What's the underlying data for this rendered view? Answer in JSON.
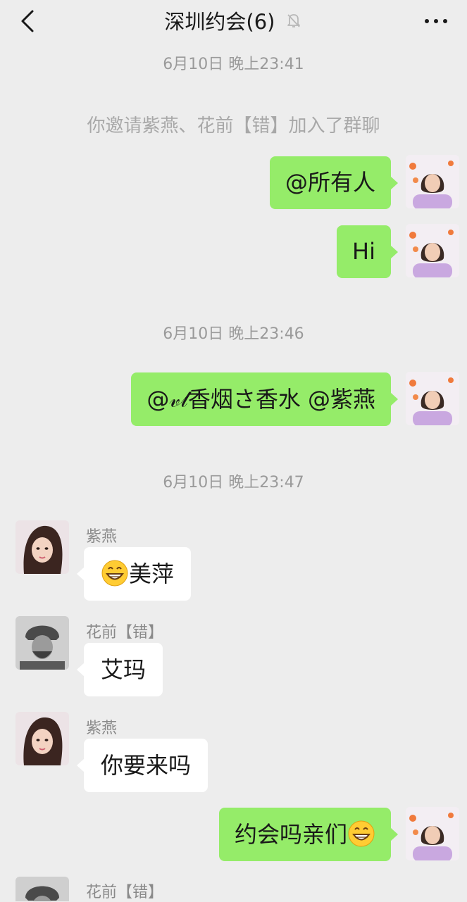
{
  "header": {
    "title": "深圳约会(6)",
    "back_icon": "chevron-left-icon",
    "mute_icon": "bell-off-icon",
    "more_icon": "more-dots-icon"
  },
  "messages": {
    "t1": "6月10日 晚上23:41",
    "sys1": "你邀请紫燕、花前【错】加入了群聊",
    "m1": "@所有人",
    "m2": "Hi",
    "t2": "6月10日 晚上23:46",
    "m3": "@𝓋𝓁香烟さ香水 @紫燕",
    "t3": "6月10日 晚上23:47",
    "s4": "紫燕",
    "m4": "美萍",
    "s5": "花前【错】",
    "m5": "艾玛",
    "s6": "紫燕",
    "m6": "你要来吗",
    "m7": "约会吗亲们",
    "s8": "花前【错】"
  },
  "colors": {
    "background": "#ededed",
    "my_bubble": "#95ec69",
    "other_bubble": "#ffffff"
  }
}
